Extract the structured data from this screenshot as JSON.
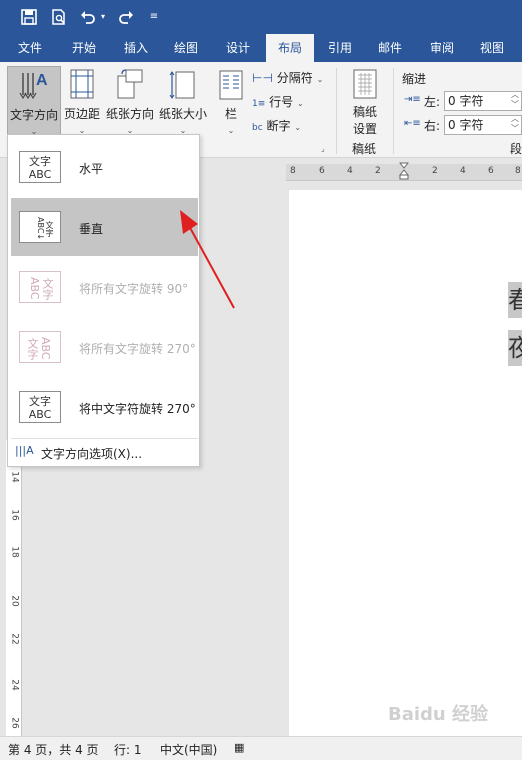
{
  "title_bar": {
    "qat_icons": [
      "save-icon",
      "print-preview-icon",
      "undo-icon",
      "undo-dropdown-icon",
      "redo-icon",
      "customize-qat-icon"
    ]
  },
  "tabs": [
    {
      "label": "文件"
    },
    {
      "label": "开始"
    },
    {
      "label": "插入"
    },
    {
      "label": "绘图"
    },
    {
      "label": "设计"
    },
    {
      "label": "布局",
      "active": true
    },
    {
      "label": "引用"
    },
    {
      "label": "邮件"
    },
    {
      "label": "审阅"
    },
    {
      "label": "视图"
    }
  ],
  "ribbon": {
    "text_direction": "文字方向",
    "margins": "页边距",
    "orientation": "纸张方向",
    "size": "纸张大小",
    "columns": "栏",
    "breaks": "分隔符",
    "line_numbers": "行号",
    "hyphenation": "断字",
    "paper_setup_line1": "稿纸",
    "paper_setup_line2": "设置",
    "group_paper": "稿纸",
    "indent_title": "缩进",
    "indent_left_label": "左:",
    "indent_left_value": "0 字符",
    "indent_right_label": "右:",
    "indent_right_value": "0 字符",
    "group_paragraph_partial": "段"
  },
  "dropdown": {
    "items": [
      {
        "label": "水平",
        "icon_text": "文字ABC",
        "enabled": true
      },
      {
        "label": "垂直",
        "icon_text": "文字ABC",
        "enabled": true,
        "selected": true
      },
      {
        "label": "将所有文字旋转 90°",
        "icon_text": "文字ABC",
        "enabled": false
      },
      {
        "label": "将所有文字旋转 270°",
        "icon_text": "文字ABC",
        "enabled": false
      },
      {
        "label": "将中文字符旋转 270°",
        "icon_text": "文字ABC",
        "enabled": true
      }
    ],
    "options_label": "文字方向选项(X)..."
  },
  "ruler": {
    "h_numbers": [
      "8",
      "6",
      "4",
      "2",
      "2",
      "4",
      "6",
      "8"
    ],
    "v_numbers": [
      "14",
      "16",
      "18",
      "20",
      "22",
      "24",
      "26"
    ]
  },
  "document": {
    "chars": [
      "春",
      "夜"
    ]
  },
  "status": {
    "page": "第 4 页，共 4 页",
    "line": "行: 1",
    "language": "中文(中国)"
  },
  "watermark": "Baidu 经验",
  "colors": {
    "accent": "#2b579a",
    "arrow": "#e02020"
  }
}
